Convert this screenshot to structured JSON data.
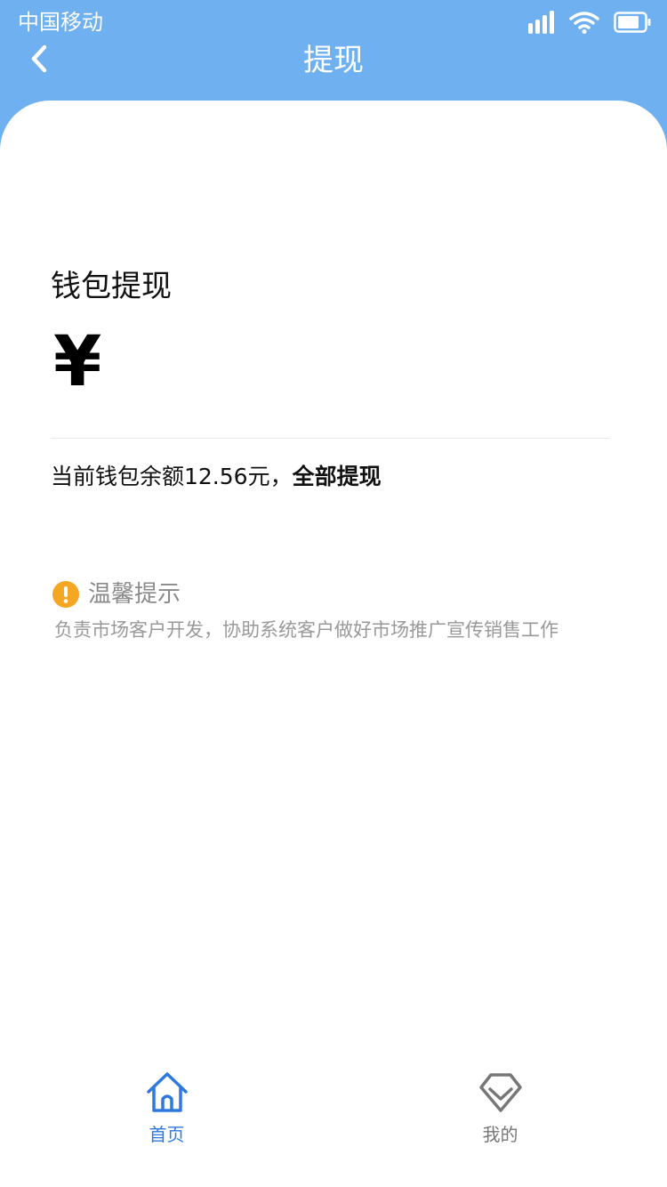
{
  "status_bar": {
    "carrier": "中国移动"
  },
  "header": {
    "title": "提现",
    "color": "#6fb0f0"
  },
  "withdraw": {
    "title": "钱包提现",
    "currency_symbol": "¥",
    "amount_value": "",
    "balance_prefix": "当前钱包余额12.56元，",
    "withdraw_all_label": "全部提现"
  },
  "tip": {
    "title": "温馨提示",
    "content": "负责市场客户开发，协助系统客户做好市场推广宣传销售工作",
    "icon_color": "#f5a623"
  },
  "tab_bar": {
    "items": [
      {
        "label": "首页",
        "icon": "home-icon",
        "active": true
      },
      {
        "label": "我的",
        "icon": "diamond-icon",
        "active": false
      }
    ],
    "active_color": "#2f78e0"
  }
}
